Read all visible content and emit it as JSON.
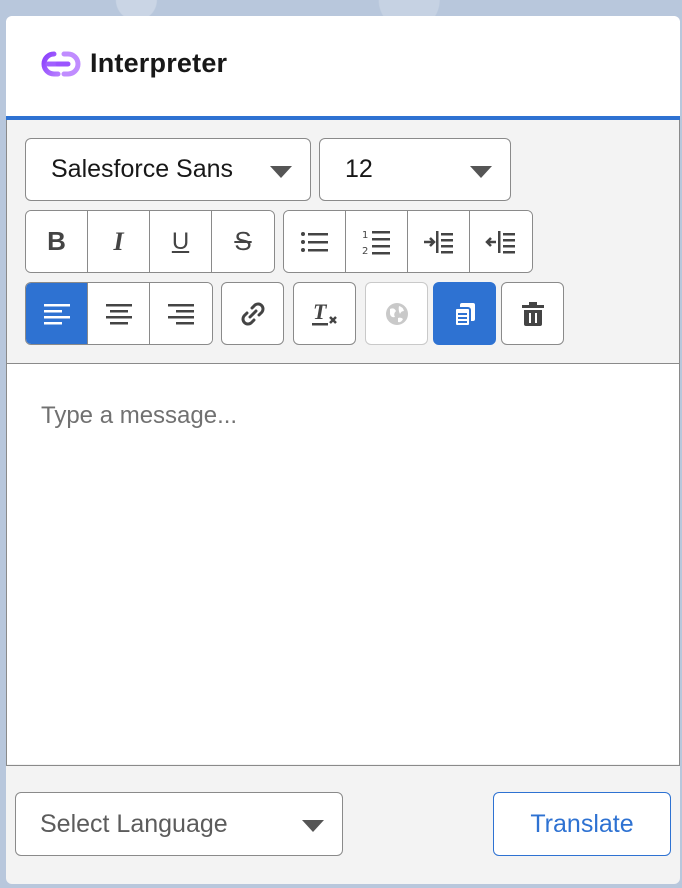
{
  "app": {
    "title": "Interpreter",
    "accent_color": "#2e72d2",
    "logo_icon": "interlinked-rings-logo"
  },
  "toolbar": {
    "font_family": {
      "selected": "Salesforce Sans"
    },
    "font_size": {
      "selected": "12"
    },
    "format_buttons": [
      {
        "icon": "bold-icon",
        "glyph": "B"
      },
      {
        "icon": "italic-icon",
        "glyph": "I"
      },
      {
        "icon": "underline-icon",
        "glyph": "U"
      },
      {
        "icon": "strikethrough-icon",
        "glyph": "S"
      }
    ],
    "list_buttons": [
      {
        "icon": "bulleted-list-icon"
      },
      {
        "icon": "numbered-list-icon"
      },
      {
        "icon": "indent-icon"
      },
      {
        "icon": "outdent-icon"
      }
    ],
    "align_buttons": [
      {
        "icon": "align-left-icon",
        "active": true
      },
      {
        "icon": "align-center-icon",
        "active": false
      },
      {
        "icon": "align-right-icon",
        "active": false
      }
    ],
    "link_icon": "link-icon",
    "clear_format_icon": "remove-formatting-icon",
    "globe_icon": "globe-icon",
    "copy_icon": "copy-icon",
    "delete_icon": "trash-icon"
  },
  "editor": {
    "placeholder": "Type a message..."
  },
  "footer": {
    "language_placeholder": "Select Language",
    "translate_label": "Translate"
  }
}
